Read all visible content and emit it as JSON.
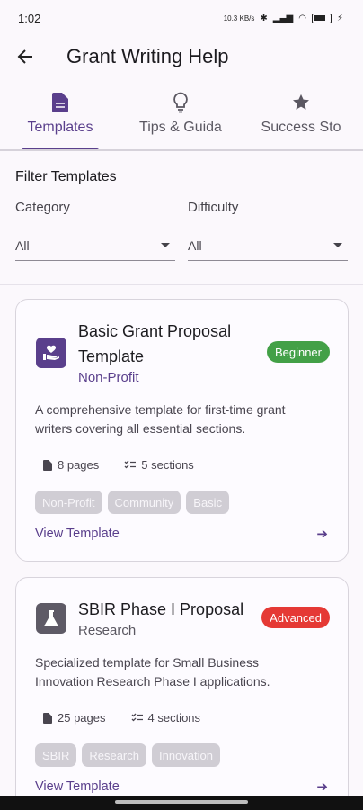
{
  "status": {
    "time": "1:02",
    "network_speed": "10.3 KB/s",
    "battery_percent": 0.6
  },
  "header": {
    "title": "Grant Writing Help"
  },
  "tabs": [
    {
      "label": "Templates",
      "icon": "document-icon",
      "active": true
    },
    {
      "label": "Tips & Guida",
      "icon": "lightbulb-icon",
      "active": false
    },
    {
      "label": "Success Sto",
      "icon": "star-icon",
      "active": false
    }
  ],
  "filters": {
    "title": "Filter Templates",
    "category_label": "Category",
    "category_value": "All",
    "difficulty_label": "Difficulty",
    "difficulty_value": "All"
  },
  "templates": [
    {
      "title_line1": "Basic Grant Proposal",
      "title_line2": "Template",
      "category": "Non-Profit",
      "category_color": "#5a3f8c",
      "icon": "volunteer-icon",
      "difficulty": "Beginner",
      "difficulty_color": "#43a047",
      "description_line1": "A comprehensive template for first-time grant",
      "description_line2": "writers covering all essential sections.",
      "pages": "8 pages",
      "sections": "5 sections",
      "tags": [
        "Non-Profit",
        "Community",
        "Basic"
      ],
      "link": "View Template"
    },
    {
      "title_line1": "SBIR Phase I Proposal",
      "title_line2": "",
      "category": "Research",
      "category_color": "#5a5761",
      "icon": "flask-icon",
      "difficulty": "Advanced",
      "difficulty_color": "#e53935",
      "description_line1": "Specialized template for Small Business",
      "description_line2": "Innovation Research Phase I applications.",
      "pages": "25 pages",
      "sections": "4 sections",
      "tags": [
        "SBIR",
        "Research",
        "Innovation"
      ],
      "link": "View Template"
    }
  ],
  "colors": {
    "accent": "#5a3f8c",
    "beginner": "#43a047",
    "advanced": "#e53935"
  }
}
